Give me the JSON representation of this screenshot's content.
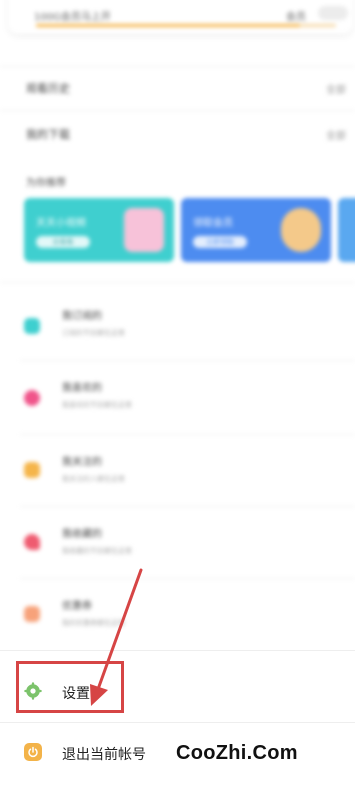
{
  "top": {
    "left_text": "100G会员马上开",
    "right_text": "会员",
    "progress": 0.88
  },
  "rows": [
    {
      "label": "观看历史",
      "right": "全部"
    },
    {
      "label": "我的下载",
      "right": "全部"
    }
  ],
  "section_title": "为你推荐",
  "banners": [
    {
      "title": "天天小视频",
      "button": "去看看",
      "color": "#3fcfcf"
    },
    {
      "title": "领取会员",
      "button": "立即领取",
      "color": "#4d8cf0"
    }
  ],
  "menu": [
    {
      "title": "我订阅的",
      "subtitle": "订阅的节目都在这里",
      "color": "#3ecfcf"
    },
    {
      "title": "我喜欢的",
      "subtitle": "我喜欢的节目都在这里",
      "color": "#f0548a"
    },
    {
      "title": "我关注的",
      "subtitle": "我关注的人都在这里",
      "color": "#f5b54a"
    },
    {
      "title": "我收藏的",
      "subtitle": "我收藏的节目都在这里",
      "color": "#ef5b70"
    },
    {
      "title": "优惠券",
      "subtitle": "我的优惠券都在这里",
      "color": "#f7a27a"
    }
  ],
  "settings": {
    "label": "设置",
    "icon": "gear-icon",
    "icon_color": "#7cc36b"
  },
  "logout": {
    "label": "退出当前帐号",
    "icon": "power-icon",
    "icon_color": "#f3b349"
  },
  "annotation": {
    "color": "#d64545"
  },
  "watermark": "CooZhi.Com"
}
